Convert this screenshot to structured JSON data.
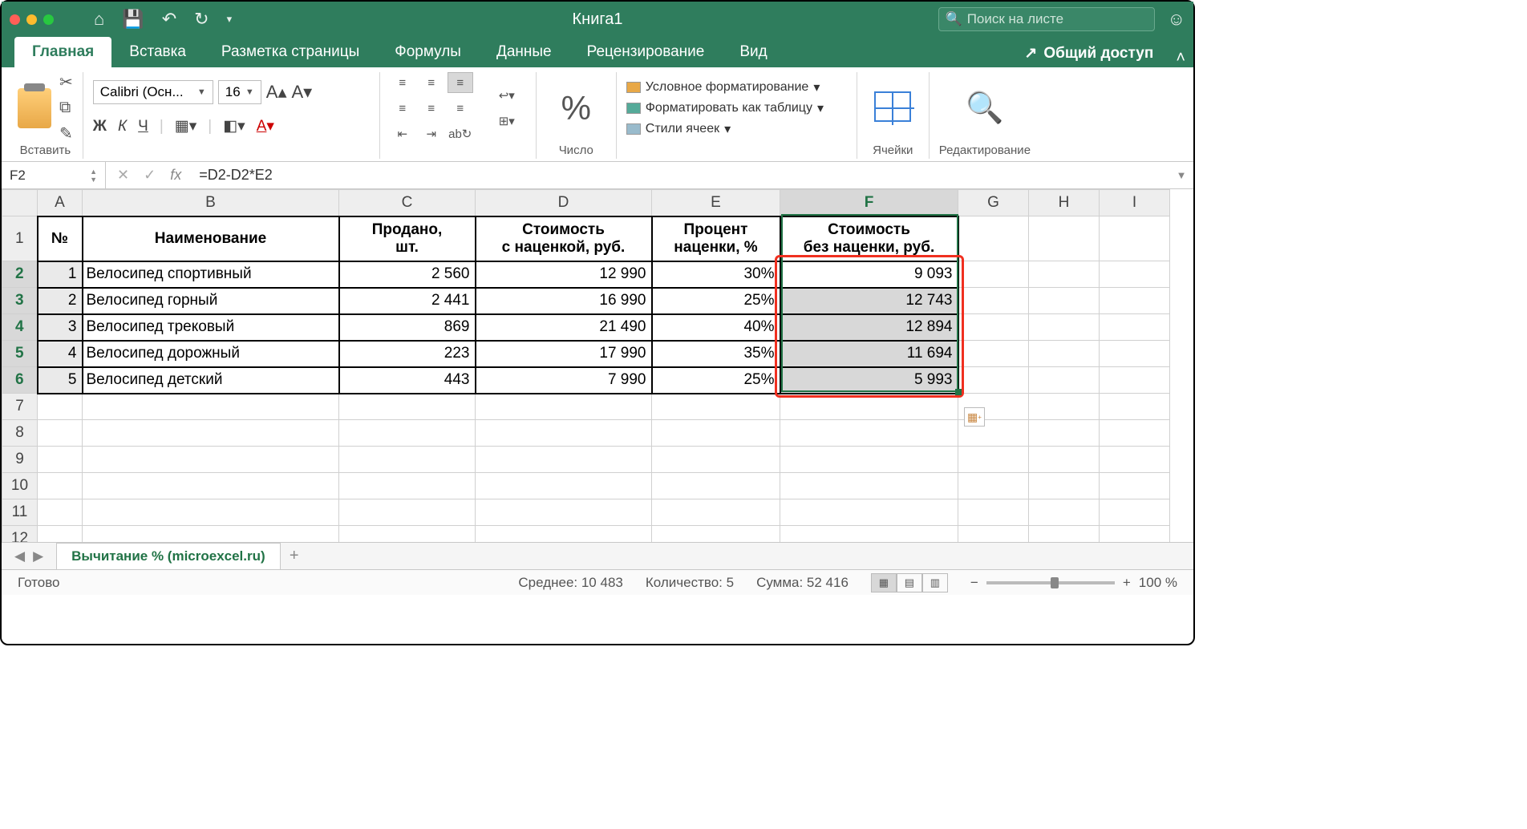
{
  "title": "Книга1",
  "search_placeholder": "Поиск на листе",
  "tabs": [
    "Главная",
    "Вставка",
    "Разметка страницы",
    "Формулы",
    "Данные",
    "Рецензирование",
    "Вид"
  ],
  "share_label": "Общий доступ",
  "ribbon": {
    "paste": "Вставить",
    "font_name": "Calibri (Осн...",
    "font_size": "16",
    "bold": "Ж",
    "italic": "К",
    "underline": "Ч",
    "number_label": "Число",
    "cond_fmt": "Условное форматирование",
    "fmt_table": "Форматировать как таблицу",
    "cell_styles": "Стили ячеек",
    "cells_label": "Ячейки",
    "editing_label": "Редактирование"
  },
  "formula_bar": {
    "cell_ref": "F2",
    "formula": "=D2-D2*E2"
  },
  "columns": [
    "A",
    "B",
    "C",
    "D",
    "E",
    "F",
    "G",
    "H",
    "I"
  ],
  "row_numbers": [
    1,
    2,
    3,
    4,
    5,
    6,
    7,
    8,
    9,
    10,
    11,
    12
  ],
  "headers": {
    "num": "№",
    "name": "Наименование",
    "sold": "Продано,\nшт.",
    "cost_markup": "Стоимость\nс наценкой, руб.",
    "markup_pct": "Процент\nнаценки, %",
    "cost_nomarkup": "Стоимость\nбез наценки, руб."
  },
  "rows": [
    {
      "n": "1",
      "name": "Велосипед спортивный",
      "sold": "2 560",
      "cost": "12 990",
      "pct": "30%",
      "nom": "9 093"
    },
    {
      "n": "2",
      "name": "Велосипед горный",
      "sold": "2 441",
      "cost": "16 990",
      "pct": "25%",
      "nom": "12 743"
    },
    {
      "n": "3",
      "name": "Велосипед трековый",
      "sold": "869",
      "cost": "21 490",
      "pct": "40%",
      "nom": "12 894"
    },
    {
      "n": "4",
      "name": "Велосипед дорожный",
      "sold": "223",
      "cost": "17 990",
      "pct": "35%",
      "nom": "11 694"
    },
    {
      "n": "5",
      "name": "Велосипед детский",
      "sold": "443",
      "cost": "7 990",
      "pct": "25%",
      "nom": "5 993"
    }
  ],
  "sheet_tab": "Вычитание % (microexcel.ru)",
  "status": {
    "ready": "Готово",
    "avg": "Среднее: 10 483",
    "count": "Количество: 5",
    "sum": "Сумма: 52 416",
    "zoom": "100 %"
  }
}
